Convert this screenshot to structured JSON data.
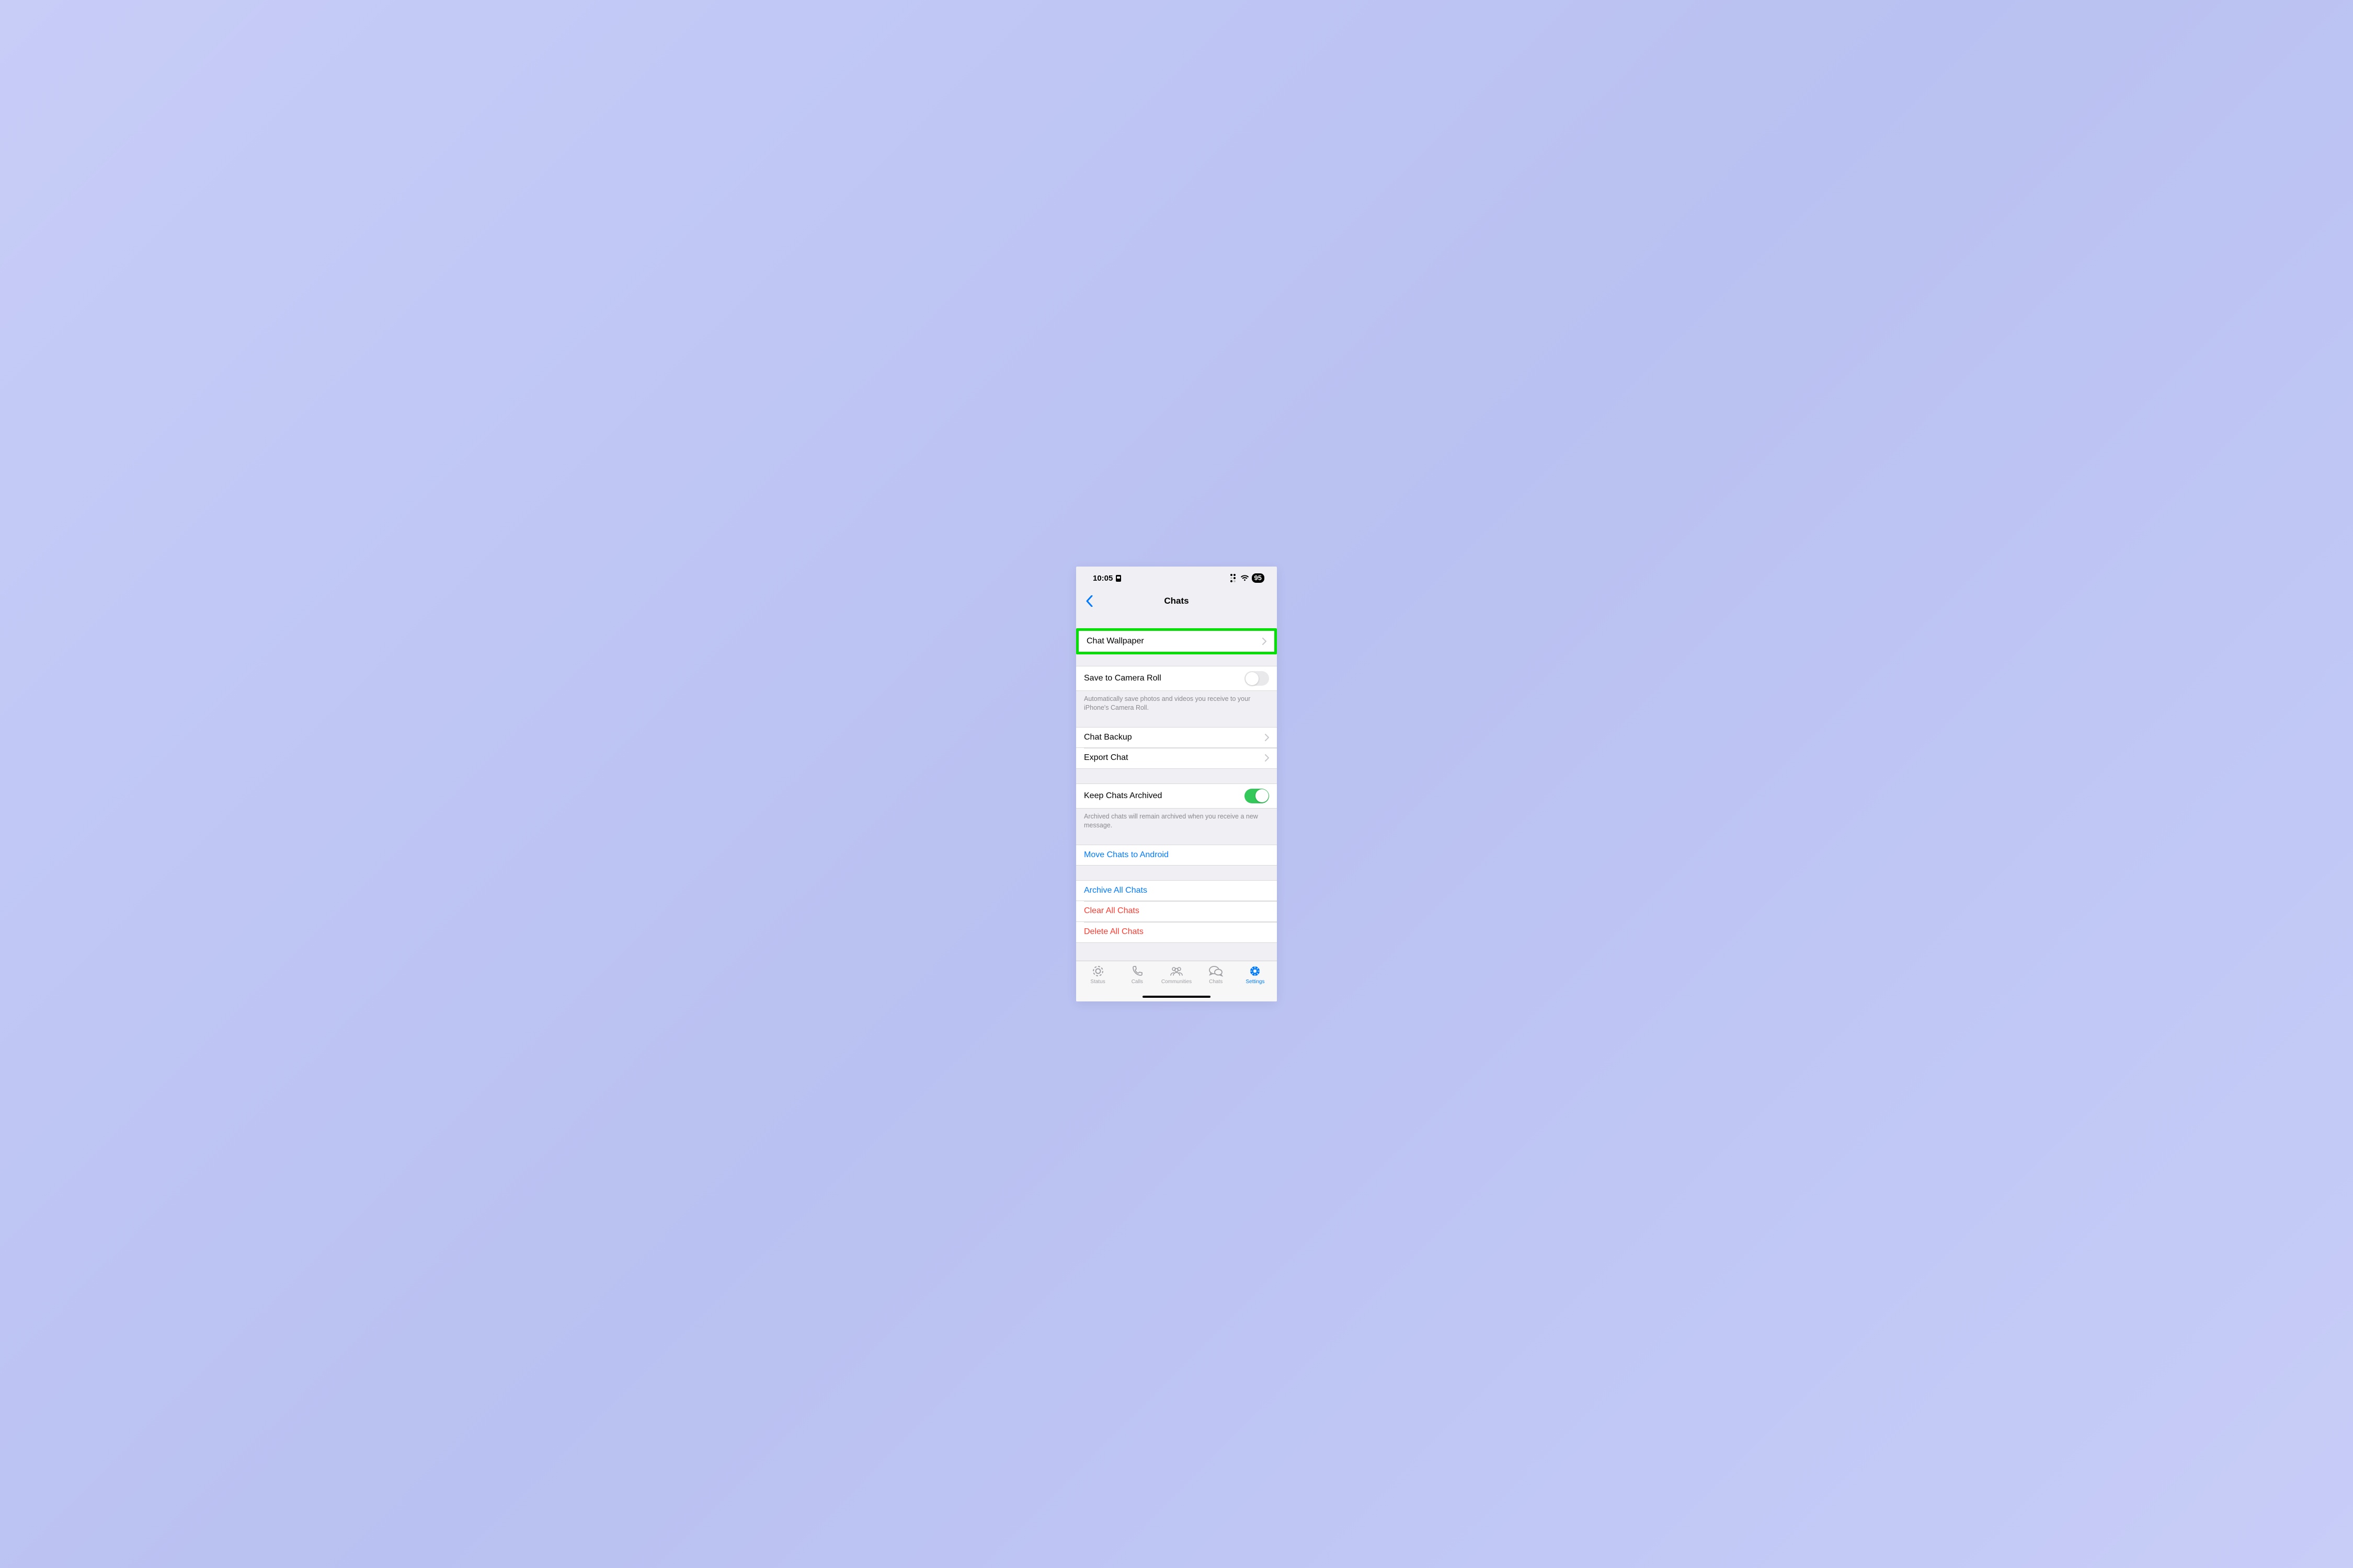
{
  "status": {
    "time": "10:05",
    "battery": "95"
  },
  "nav": {
    "title": "Chats"
  },
  "rows": {
    "wallpaper": "Chat Wallpaper",
    "save_camera": "Save to Camera Roll",
    "save_camera_footer": "Automatically save photos and videos you receive to your iPhone's Camera Roll.",
    "backup": "Chat Backup",
    "export": "Export Chat",
    "keep_archived": "Keep Chats Archived",
    "keep_archived_footer": "Archived chats will remain archived when you receive a new message.",
    "move_android": "Move Chats to Android",
    "archive_all": "Archive All Chats",
    "clear_all": "Clear All Chats",
    "delete_all": "Delete All Chats"
  },
  "toggles": {
    "save_camera": false,
    "keep_archived": true
  },
  "tabs": {
    "status": "Status",
    "calls": "Calls",
    "communities": "Communities",
    "chats": "Chats",
    "settings": "Settings"
  }
}
